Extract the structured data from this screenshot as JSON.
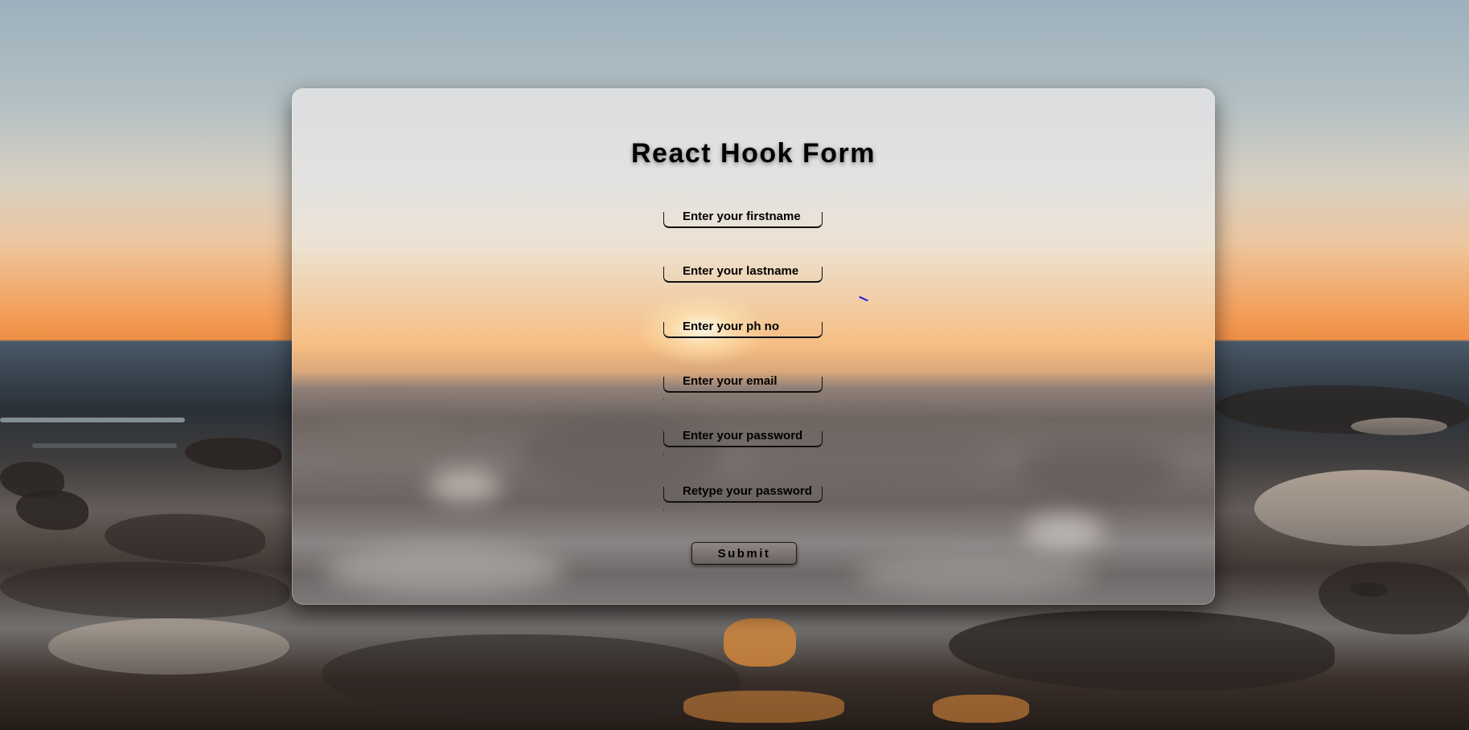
{
  "form": {
    "title": "React Hook Form",
    "fields": [
      {
        "label": "Enter your firstname"
      },
      {
        "label": "Enter your lastname"
      },
      {
        "label": "Enter your ph no"
      },
      {
        "label": "Enter your email"
      },
      {
        "label": "Enter your password"
      },
      {
        "label": "Retype your password"
      }
    ],
    "submit_label": "Submit"
  },
  "colors": {
    "sky_top": "#9cb0bd",
    "sunset_orange": "#f39a52",
    "card_glass": "#dcdde0",
    "text": "#000000",
    "cursor_blue": "#1c1cd8"
  },
  "icons": {
    "cursor": "text-cursor-icon"
  }
}
